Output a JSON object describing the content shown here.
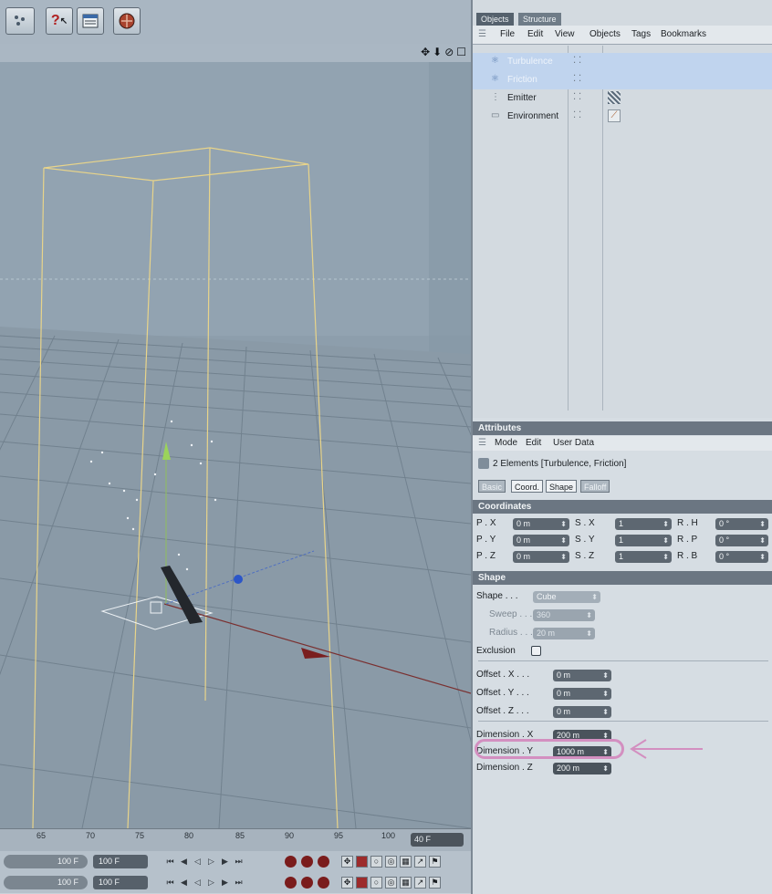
{
  "toolbar": {
    "icons": [
      "select-points-icon",
      "help-cursor-icon",
      "render-region-icon",
      "render-icon"
    ]
  },
  "viewport": {
    "header_icons": "✥⬇⊘☐",
    "colors": {
      "bg": "#8d9eac",
      "box": "#e8d48a",
      "grid": "#6c7c89",
      "x_axis": "#8c2b2b",
      "y_axis": "#8fd35a",
      "z_axis": "#2a4fb8"
    }
  },
  "timeline": {
    "ticks": [
      "65",
      "70",
      "75",
      "80",
      "85",
      "90",
      "95",
      "100"
    ],
    "current_frame": "40 F",
    "row1": {
      "start": "100 F",
      "end": "100 F"
    },
    "row2": {
      "start": "100 F",
      "end": "100 F"
    }
  },
  "objects": {
    "tabs": [
      "Objects",
      "Structure"
    ],
    "menu": [
      "File",
      "Edit",
      "View",
      "Objects",
      "Tags",
      "Bookmarks"
    ],
    "tree": [
      "Turbulence",
      "Friction",
      "Emitter",
      "Environment"
    ]
  },
  "attributes": {
    "title": "Attributes",
    "menu": [
      "Mode",
      "Edit",
      "User Data"
    ],
    "selection": "2 Elements [Turbulence, Friction]",
    "tabs": [
      "Basic",
      "Coord.",
      "Shape",
      "Falloff"
    ],
    "coordinates": {
      "header": "Coordinates",
      "rows": [
        {
          "a_label": "P . X",
          "a_val": "0 m",
          "b_label": "S . X",
          "b_val": "1",
          "c_label": "R . H",
          "c_val": "0 °"
        },
        {
          "a_label": "P . Y",
          "a_val": "0 m",
          "b_label": "S . Y",
          "b_val": "1",
          "c_label": "R . P",
          "c_val": "0 °"
        },
        {
          "a_label": "P . Z",
          "a_val": "0 m",
          "b_label": "S . Z",
          "b_val": "1",
          "c_label": "R . B",
          "c_val": "0 °"
        }
      ]
    },
    "shape": {
      "header": "Shape",
      "shape_label": "Shape . . .",
      "shape_value": "Cube",
      "sweep_label": "Sweep . . .",
      "sweep_value": "360",
      "radius_label": "Radius . . .",
      "radius_value": "20 m",
      "exclusion_label": "Exclusion",
      "offset_x_label": "Offset . X . . .",
      "offset_x": "0 m",
      "offset_y_label": "Offset . Y . . .",
      "offset_y": "0 m",
      "offset_z_label": "Offset . Z . . .",
      "offset_z": "0 m",
      "dim_x_label": "Dimension . X",
      "dim_x": "200 m",
      "dim_y_label": "Dimension . Y",
      "dim_y": "1000 m",
      "dim_z_label": "Dimension . Z",
      "dim_z": "200 m"
    }
  }
}
